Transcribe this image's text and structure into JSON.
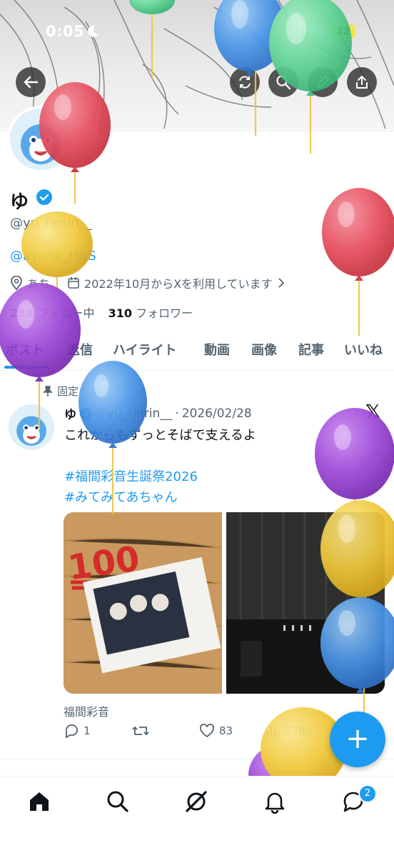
{
  "status_bar": {
    "time": "0:05",
    "battery": "22"
  },
  "profile": {
    "name": "ゆ",
    "handle": "@yu_rinrin__",
    "bio_link": "@ayane_HNS",
    "location": "あち",
    "joined": "2022年10月からXを利用しています",
    "following_count": "288",
    "following_label": "フォロー中",
    "followers_count": "310",
    "followers_label": "フォロワー"
  },
  "tabs": [
    {
      "label": "ポスト"
    },
    {
      "label": "返信"
    },
    {
      "label": "ハイライト"
    },
    {
      "label": "動画"
    },
    {
      "label": "画像"
    },
    {
      "label": "記事"
    },
    {
      "label": "いいね"
    }
  ],
  "pinned_post": {
    "pinned_label": "固定",
    "author_name": "ゆ",
    "author_handle": "@yu_rinrin__",
    "separator": "·",
    "date": "2026/02/28",
    "text": "これからもずっとそばで支えるよ",
    "hashtags": [
      "#福間彩音生誕祭2026",
      "#みてみてあちゃん"
    ],
    "media_caption": "福間彩音",
    "replies": "1",
    "likes": "83",
    "views": "5280",
    "x_logo": "𝕏"
  },
  "fab_label": "+",
  "messages_badge": "2",
  "icons": {
    "back": "back-arrow-icon",
    "refresh": "refresh-icon",
    "search": "search-icon",
    "edit": "pencil-icon",
    "share": "share-icon"
  },
  "colors": {
    "accent": "#1d9bf0",
    "text": "#0f1419",
    "secondary": "#536471"
  }
}
